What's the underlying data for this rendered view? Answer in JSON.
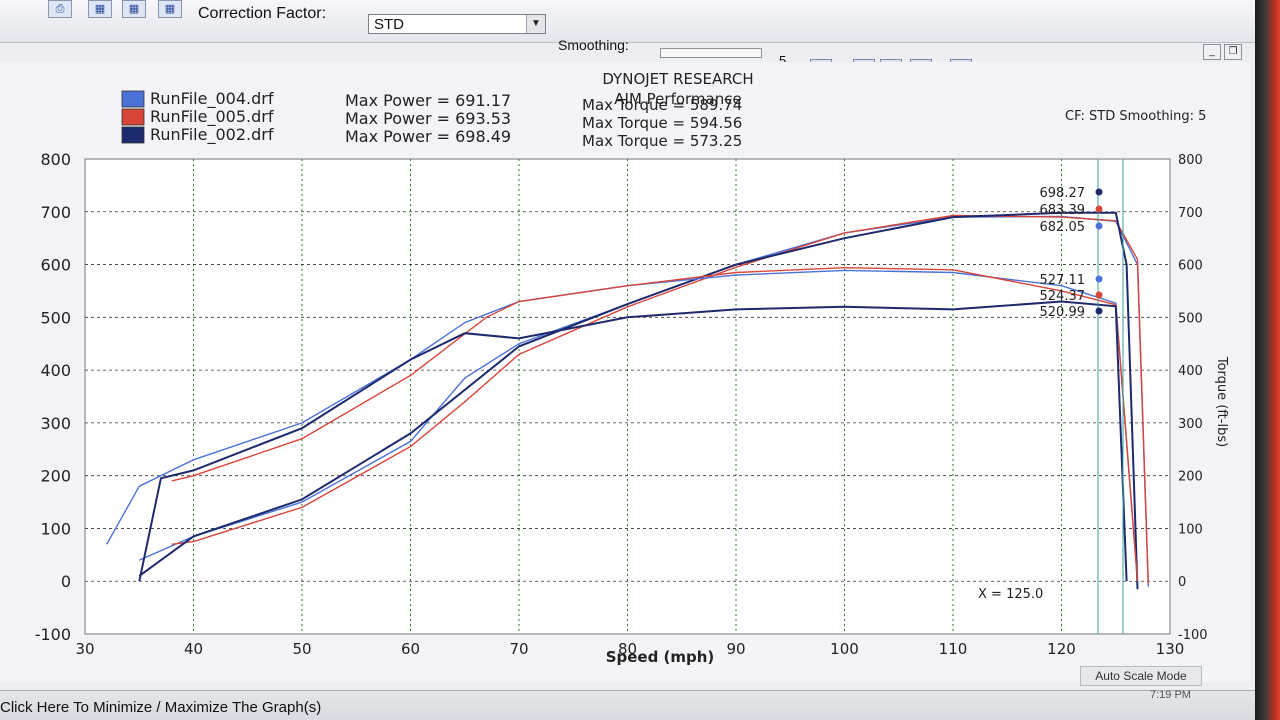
{
  "toolbar": {
    "correction_factor_label": "Correction Factor:",
    "correction_factor_value": "STD",
    "smoothing_label": "Smoothing:",
    "smoothing_value": "5",
    "icons": [
      "print-icon",
      "graph-view-icon",
      "graph-view-icon",
      "graph-view-icon",
      "clear-icon",
      "zoom-icon",
      "hand-pan-icon",
      "fit-icon",
      "crosshair-icon"
    ]
  },
  "graph": {
    "title": "DYNOJET RESEARCH",
    "subtitle": "AIM Performance",
    "info_right": "CF: STD   Smoothing: 5",
    "legend": [
      {
        "file": "RunFile_004.drf",
        "power_text": "Max Power = 691.17",
        "torque_text": "Max Torque = 589.74",
        "color": "#4a72d8"
      },
      {
        "file": "RunFile_005.drf",
        "power_text": "Max Power = 693.53",
        "torque_text": "Max Torque = 594.56",
        "color": "#d8463a"
      },
      {
        "file": "RunFile_002.drf",
        "power_text": "Max Power = 698.49",
        "torque_text": "Max Torque = 573.25",
        "color": "#1e2a6e"
      }
    ],
    "cursor_readout": "X = 125.0",
    "cursor_power_values": [
      {
        "text": "698.27",
        "color": "#1e2a6e"
      },
      {
        "text": "683.39",
        "color": "#d8463a"
      },
      {
        "text": "682.05",
        "color": "#4a72d8"
      }
    ],
    "cursor_torque_values": [
      {
        "text": "527.11",
        "color": "#4a72d8"
      },
      {
        "text": "524.37",
        "color": "#d8463a"
      },
      {
        "text": "520.99",
        "color": "#1e2a6e"
      }
    ]
  },
  "chart_data": {
    "type": "line",
    "title": "DYNOJET RESEARCH",
    "subtitle": "AIM Performance",
    "xlabel": "Speed (mph)",
    "ylabel": "",
    "y2label": "Torque (ft-lbs)",
    "xlim": [
      30,
      130
    ],
    "ylim": [
      -100,
      800
    ],
    "y2lim": [
      -100,
      800
    ],
    "x_ticks": [
      30,
      40,
      50,
      60,
      70,
      80,
      90,
      100,
      110,
      120,
      130
    ],
    "y_ticks": [
      -100,
      0,
      100,
      200,
      300,
      400,
      500,
      600,
      700,
      800
    ],
    "y2_ticks": [
      -100,
      0,
      100,
      200,
      300,
      400,
      500,
      600,
      700,
      800
    ],
    "grid": true,
    "cursor_x": 125.0,
    "series": [
      {
        "name": "RunFile_004.drf",
        "kind": "power",
        "color": "#4a72d8",
        "x": [
          35,
          40,
          50,
          60,
          65,
          70,
          80,
          90,
          100,
          110,
          120,
          125,
          127,
          128
        ],
        "y": [
          40,
          85,
          150,
          265,
          385,
          450,
          525,
          600,
          660,
          690,
          691,
          682,
          600,
          -10
        ]
      },
      {
        "name": "RunFile_005.drf",
        "kind": "power",
        "color": "#d8463a",
        "x": [
          38,
          40,
          50,
          60,
          65,
          70,
          80,
          90,
          100,
          110,
          120,
          125,
          127,
          128
        ],
        "y": [
          70,
          75,
          140,
          255,
          340,
          430,
          520,
          595,
          660,
          693,
          690,
          683,
          610,
          -5
        ]
      },
      {
        "name": "RunFile_002.drf",
        "kind": "power",
        "color": "#1e2a6e",
        "x": [
          35,
          40,
          50,
          60,
          70,
          80,
          90,
          100,
          110,
          120,
          125,
          126,
          127
        ],
        "y": [
          10,
          85,
          155,
          280,
          445,
          525,
          600,
          650,
          690,
          698,
          698,
          600,
          -15
        ]
      },
      {
        "name": "RunFile_004.drf",
        "kind": "torque",
        "color": "#4a72d8",
        "x": [
          32,
          35,
          40,
          50,
          60,
          65,
          70,
          80,
          90,
          100,
          110,
          120,
          125,
          127
        ],
        "y": [
          70,
          180,
          230,
          300,
          420,
          490,
          530,
          560,
          580,
          589,
          585,
          560,
          527,
          0
        ]
      },
      {
        "name": "RunFile_005.drf",
        "kind": "torque",
        "color": "#d8463a",
        "x": [
          38,
          40,
          50,
          60,
          67,
          70,
          80,
          90,
          100,
          110,
          120,
          125,
          127
        ],
        "y": [
          190,
          200,
          270,
          390,
          500,
          530,
          560,
          585,
          594,
          590,
          550,
          524,
          0
        ]
      },
      {
        "name": "RunFile_002.drf",
        "kind": "torque",
        "color": "#1e2a6e",
        "x": [
          35,
          37,
          40,
          50,
          60,
          65,
          70,
          80,
          90,
          100,
          110,
          120,
          125,
          126
        ],
        "y": [
          0,
          195,
          210,
          290,
          420,
          470,
          460,
          500,
          515,
          520,
          515,
          530,
          521,
          0
        ]
      }
    ]
  },
  "status": {
    "left_text": "Click Here To Minimize / Maximize The Graph(s)",
    "auto_scale": "Auto Scale Mode",
    "clock": "7:19 PM"
  }
}
